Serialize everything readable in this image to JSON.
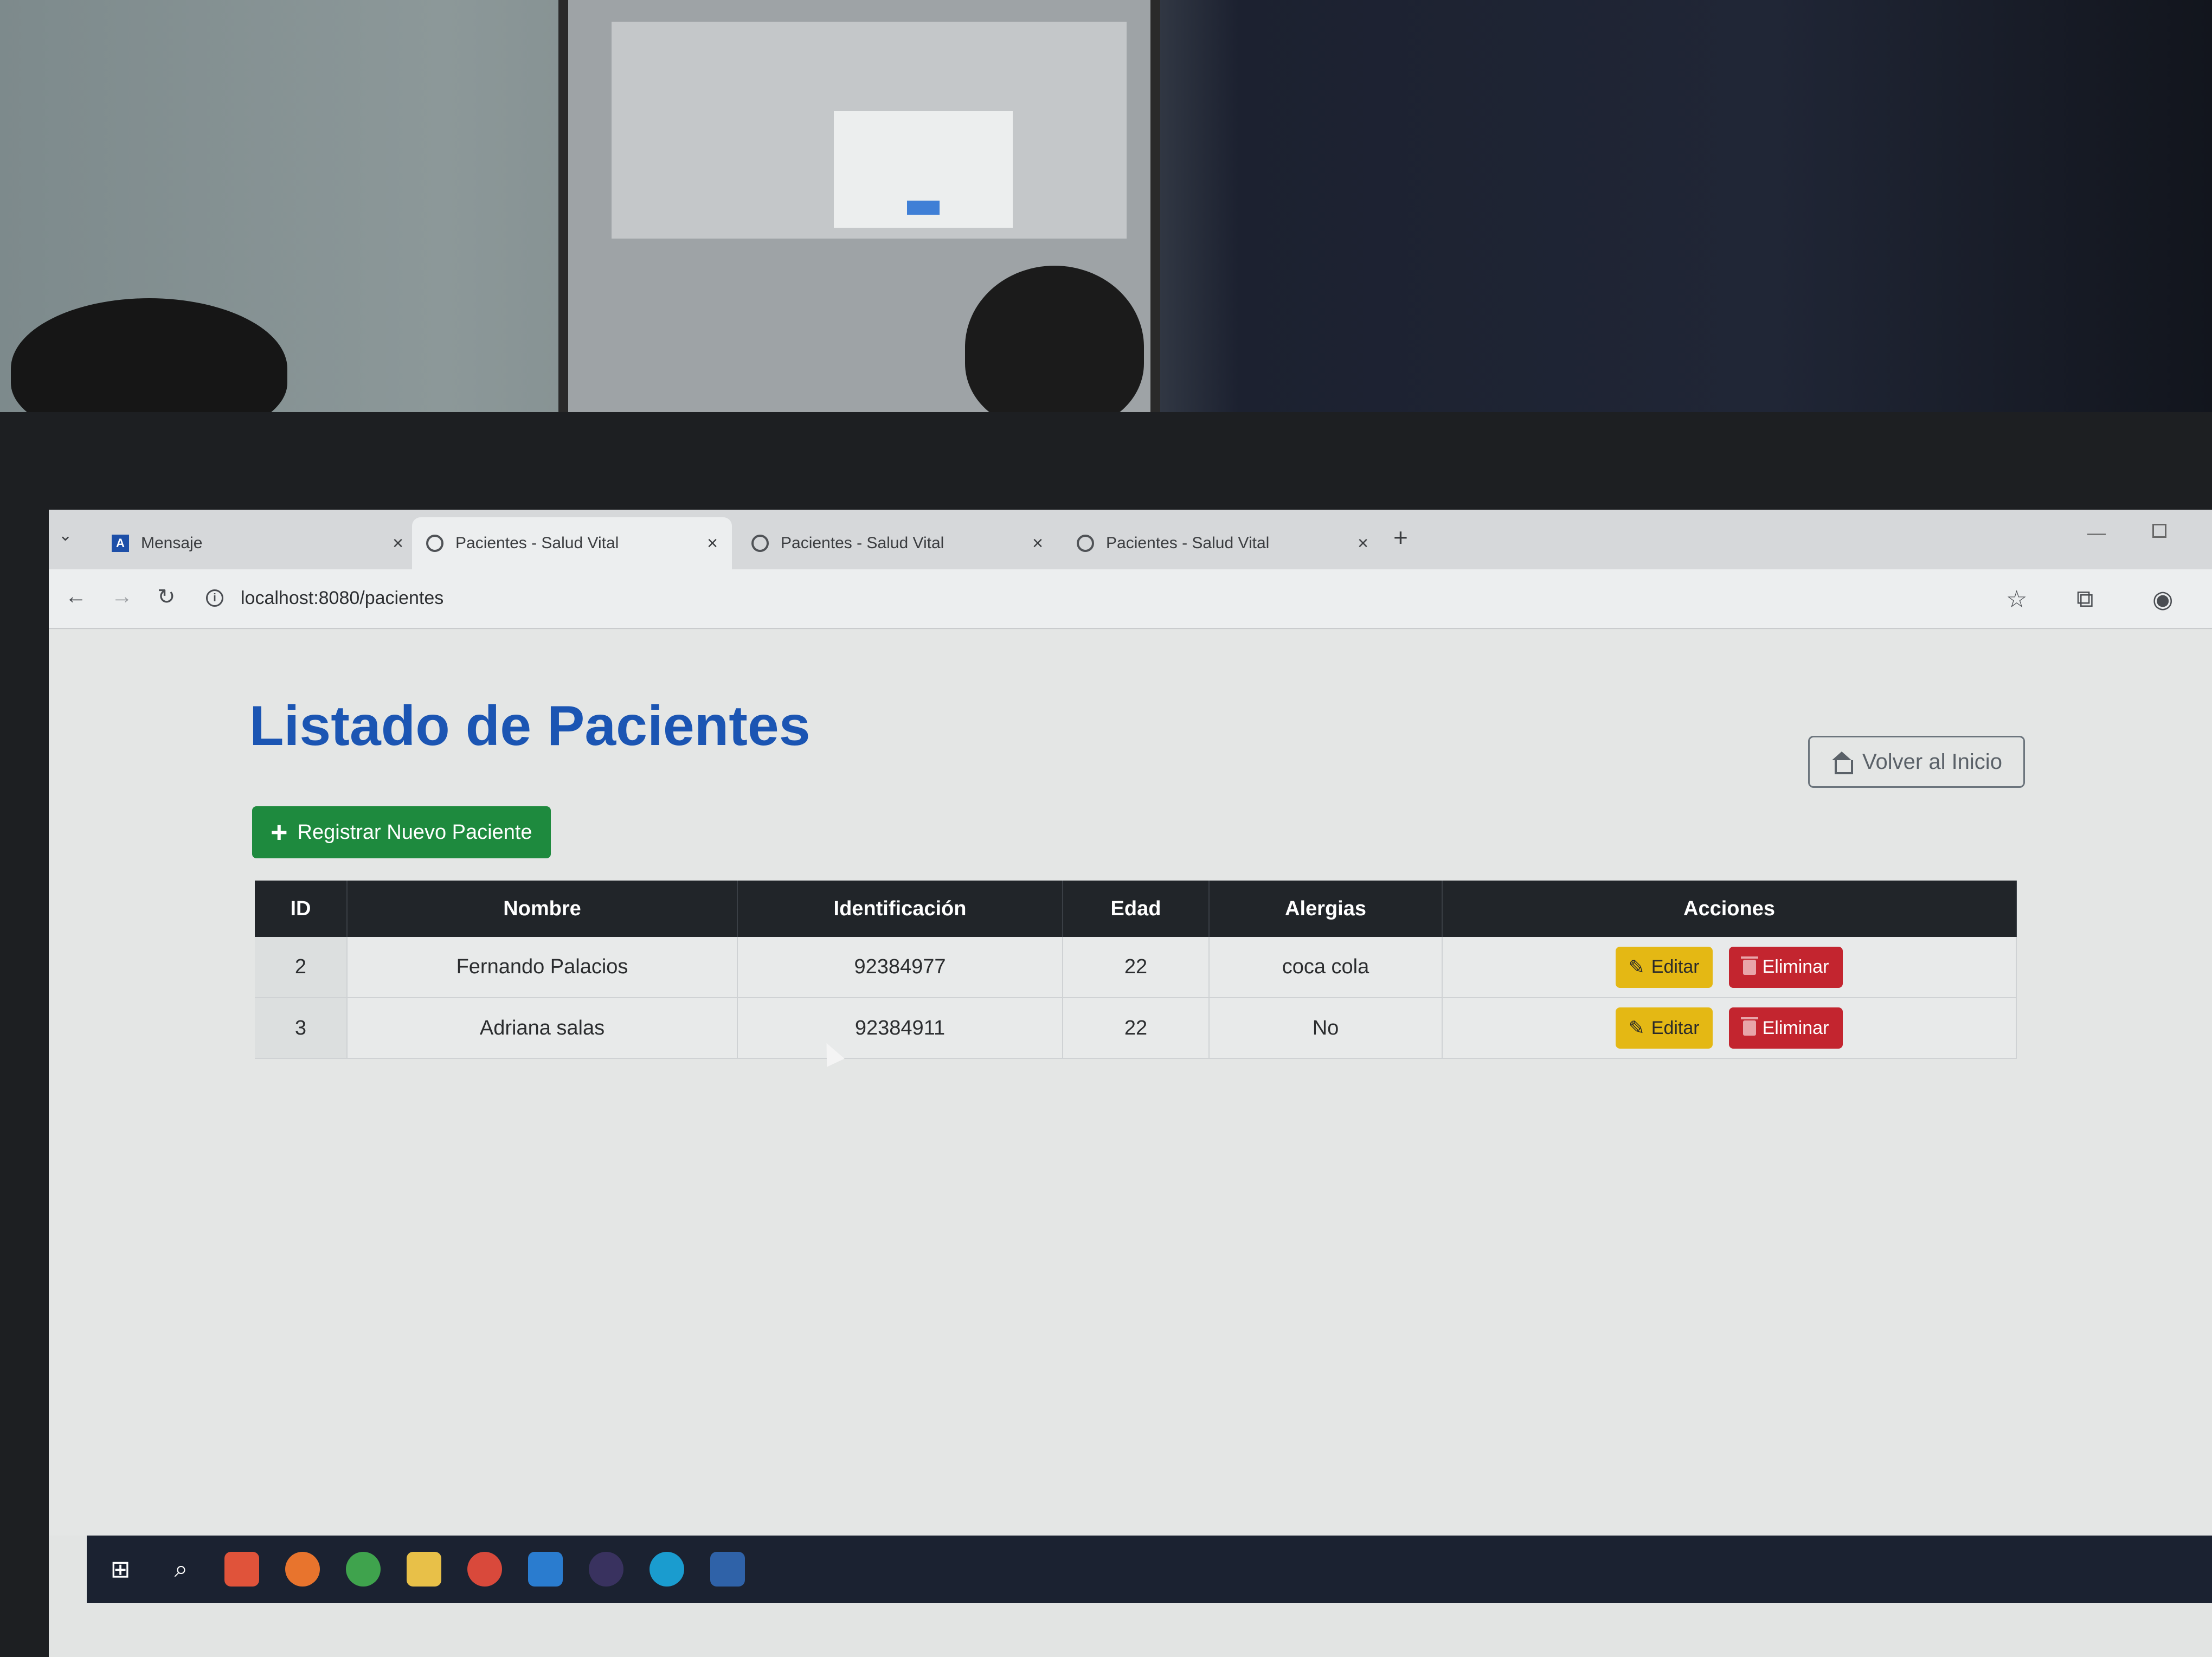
{
  "browser": {
    "tabs": [
      {
        "title": "Mensaje",
        "icon": "app-icon",
        "active": false
      },
      {
        "title": "Pacientes - Salud Vital",
        "icon": "globe-icon",
        "active": true
      },
      {
        "title": "Pacientes - Salud Vital",
        "icon": "globe-icon",
        "active": false
      },
      {
        "title": "Pacientes - Salud Vital",
        "icon": "globe-icon",
        "active": false
      }
    ],
    "app_icon_letter": "A",
    "url": "localhost:8080/pacientes"
  },
  "page": {
    "title": "Listado de Pacientes",
    "home_button": "Volver al Inicio",
    "add_button": "Registrar Nuevo Paciente"
  },
  "table": {
    "headers": [
      "ID",
      "Nombre",
      "Identificación",
      "Edad",
      "Alergias",
      "Acciones"
    ],
    "rows": [
      {
        "id": "2",
        "nombre": "Fernando Palacios",
        "identificacion": "92384977",
        "edad": "22",
        "alergias": "coca cola"
      },
      {
        "id": "3",
        "nombre": "Adriana salas",
        "identificacion": "92384911",
        "edad": "22",
        "alergias": "No"
      }
    ],
    "edit_label": "Editar",
    "delete_label": "Eliminar"
  },
  "colors": {
    "title": "#1b55b3",
    "add_button": "#1e8a3e",
    "edit_button": "#e4b814",
    "delete_button": "#c3252f",
    "table_header": "#212529"
  },
  "taskbar": {
    "icons": [
      "windows-start-icon",
      "search-icon",
      "brave-icon",
      "firefox-icon",
      "chrome-icon",
      "file-explorer-icon",
      "chrome-icon",
      "vscode-icon",
      "eclipse-icon",
      "edge-icon",
      "app-icon"
    ]
  }
}
